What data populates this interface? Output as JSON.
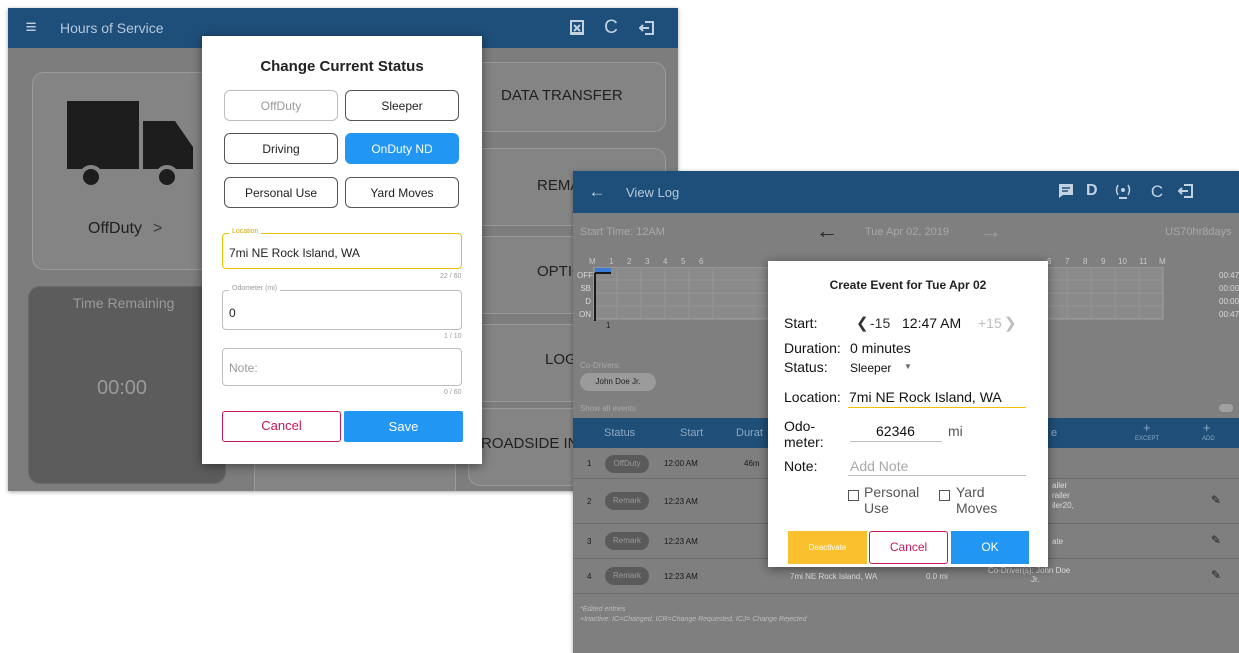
{
  "left": {
    "appbar": {
      "title": "Hours of Service"
    },
    "tiles": {
      "status_label": "OffDuty",
      "status_chevron": ">",
      "data_transfer": "DATA TRANSFER",
      "remarks": "REMA",
      "options": "OPTIO",
      "logs": "LOG",
      "time_remaining_label": "Time Remaining",
      "time_remaining_value": "00:00",
      "roadside": "ROADSIDE IN"
    },
    "dialog": {
      "title": "Change Current Status",
      "options": [
        "OffDuty",
        "Sleeper",
        "Driving",
        "OnDuty ND",
        "Personal Use",
        "Yard Moves"
      ],
      "location_legend": "Location",
      "location_value": "7mi NE Rock Island, WA",
      "location_counter": "22 / 60",
      "odometer_legend": "Odometer (mi)",
      "odometer_value": "0",
      "odometer_counter": "1 / 10",
      "note_placeholder": "Note:",
      "note_counter": "0 / 60",
      "cancel": "Cancel",
      "save": "Save"
    }
  },
  "right": {
    "appbar": {
      "title": "View Log",
      "d_label": "D"
    },
    "header": {
      "start_time": "Start Time: 12AM",
      "date": "Tue Apr 02, 2019",
      "cycle": "US70hr8days"
    },
    "graph": {
      "rows": [
        "OFF",
        "SB",
        "D",
        "ON"
      ],
      "hours": [
        "M",
        "1",
        "2",
        "3",
        "4",
        "5",
        "6",
        "6",
        "7",
        "8",
        "9",
        "10",
        "11",
        "M"
      ],
      "totals": [
        "00:47",
        "00:00",
        "00:00",
        "00:47"
      ],
      "note_count": "1"
    },
    "co_drivers_label": "Co-Drivers:",
    "co_driver_chip": "John Doe Jr.",
    "show_all_events": "Show all events",
    "table_headers": {
      "status": "Status",
      "start": "Start",
      "duration": "Durat",
      "location_tail": "e",
      "except": "EXCEPT",
      "add": "ADD"
    },
    "rows": [
      {
        "n": "1",
        "status": "OffDuty",
        "time": "12:00 AM",
        "dur": "46m"
      },
      {
        "n": "2",
        "status": "Remark",
        "time": "12:23 AM",
        "extra1": "ailer",
        "extra2": "railer",
        "extra3": "iler20,"
      },
      {
        "n": "3",
        "status": "Remark",
        "time": "12:23 AM",
        "extra1": "ate"
      },
      {
        "n": "4",
        "status": "Remark",
        "time": "12:23 AM",
        "location": "7mi NE Rock Island, WA",
        "odo": "0.0 mi",
        "codriver": "Co-Driver(s): John Doe",
        "codriver2": "Jr."
      }
    ],
    "footnote1": "*Edited entries",
    "footnote2": "+Inactive: IC=Changed, ICR=Change Requested, ICJ= Change Rejected",
    "dialog": {
      "title": "Create Event for Tue Apr 02",
      "start_label": "Start:",
      "minus": "-15",
      "start_time": "12:47 AM",
      "plus": "+15",
      "duration_label": "Duration:",
      "duration_value": "0 minutes",
      "status_label": "Status:",
      "status_value": "Sleeper",
      "location_label": "Location:",
      "location_value": "7mi NE Rock Island, WA",
      "odo_label_1": "Odo-",
      "odo_label_2": "meter:",
      "odo_value": "62346",
      "odo_unit": "mi",
      "note_label": "Note:",
      "note_placeholder": "Add Note",
      "personal_use_1": "Personal",
      "personal_use_2": "Use",
      "yard_moves_1": "Yard",
      "yard_moves_2": "Moves",
      "deactivate": "Deactivate",
      "cancel": "Cancel",
      "ok": "OK"
    }
  },
  "colors": {
    "appbar": "#1e4f7a",
    "accent_blue": "#2196f3",
    "cancel_red": "#c2185b",
    "deactivate_yellow": "#fbc02d",
    "location_underline": "#f0c000"
  }
}
